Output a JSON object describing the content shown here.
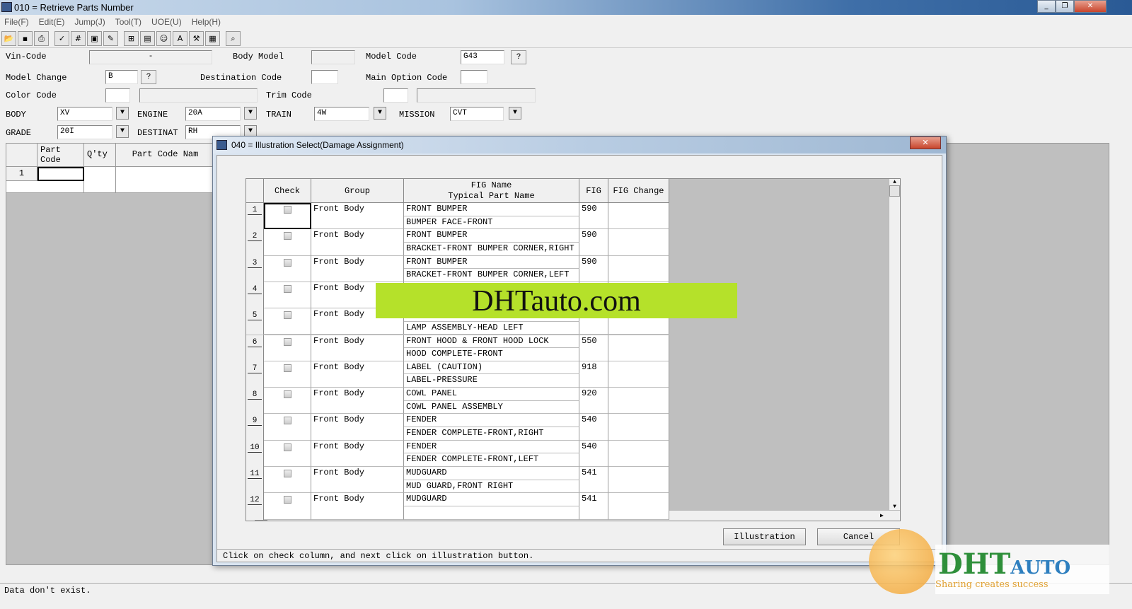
{
  "window": {
    "title": "010 = Retrieve Parts Number",
    "controls": [
      "_",
      "❐",
      "✕"
    ]
  },
  "menu": [
    "File(F)",
    "Edit(E)",
    "Jump(J)",
    "Tool(T)",
    "UOE(U)",
    "Help(H)"
  ],
  "toolbar": [
    "open-icon",
    "save-icon",
    "print-icon",
    "check-123-icon",
    "number-icon",
    "save-green-icon",
    "edit-red-icon",
    "grid-icon",
    "form-icon",
    "search-user-icon",
    "font-icon",
    "tool-icon",
    "calculator-icon",
    "find-icon"
  ],
  "form": {
    "vin_label": "Vin-Code",
    "vin_value": "-",
    "body_model_label": "Body Model",
    "body_model_value": "",
    "model_code_label": "Model Code",
    "model_code_value": "G43",
    "help": "?",
    "model_change_label": "Model Change",
    "model_change_value": "B",
    "destination_code_label": "Destination Code",
    "destination_code_value": "",
    "main_option_label": "Main Option Code",
    "main_option_value": "",
    "color_code_label": "Color Code",
    "trim_code_label": "Trim Code",
    "body_label": "BODY",
    "body_value": "XV",
    "engine_label": "ENGINE",
    "engine_value": "20A",
    "train_label": "TRAIN",
    "train_value": "4W",
    "mission_label": "MISSION",
    "mission_value": "CVT",
    "grade_label": "GRADE",
    "grade_value": "20I",
    "destinat_label": "DESTINAT",
    "destinat_value": "RH"
  },
  "parts_grid": {
    "headers": [
      "Part Code",
      "Q'ty",
      "Part Code Nam"
    ],
    "row_number": "1"
  },
  "status": "Data don't exist.",
  "dialog": {
    "title": "040 = Illustration Select(Damage Assignment)",
    "headers": {
      "check": "Check",
      "group": "Group",
      "fig_name": "FIG Name",
      "typical": "Typical Part Name",
      "fig": "FIG",
      "fig_change": "FIG Change"
    },
    "rows": [
      {
        "n": "1",
        "group": "Front Body",
        "name": "FRONT BUMPER",
        "part": "BUMPER FACE-FRONT",
        "fig": "590"
      },
      {
        "n": "2",
        "group": "Front Body",
        "name": "FRONT BUMPER",
        "part": "BRACKET-FRONT BUMPER CORNER,RIGHT",
        "fig": "590"
      },
      {
        "n": "3",
        "group": "Front Body",
        "name": "FRONT BUMPER",
        "part": "BRACKET-FRONT BUMPER CORNER,LEFT",
        "fig": "590"
      },
      {
        "n": "4",
        "group": "Front Body",
        "name": "",
        "part": "",
        "fig": ""
      },
      {
        "n": "5",
        "group": "Front Body",
        "name": "",
        "part": "LAMP ASSEMBLY-HEAD LEFT",
        "fig": ""
      },
      {
        "n": "6",
        "group": "Front Body",
        "name": "FRONT HOOD & FRONT HOOD LOCK",
        "part": "HOOD COMPLETE-FRONT",
        "fig": "550"
      },
      {
        "n": "7",
        "group": "Front Body",
        "name": "LABEL (CAUTION)",
        "part": "LABEL-PRESSURE",
        "fig": "918"
      },
      {
        "n": "8",
        "group": "Front Body",
        "name": "COWL PANEL",
        "part": "COWL PANEL ASSEMBLY",
        "fig": "920"
      },
      {
        "n": "9",
        "group": "Front Body",
        "name": "FENDER",
        "part": "FENDER COMPLETE-FRONT,RIGHT",
        "fig": "540"
      },
      {
        "n": "10",
        "group": "Front Body",
        "name": "FENDER",
        "part": "FENDER COMPLETE-FRONT,LEFT",
        "fig": "540"
      },
      {
        "n": "11",
        "group": "Front Body",
        "name": "MUDGUARD",
        "part": "MUD GUARD,FRONT RIGHT",
        "fig": "541"
      },
      {
        "n": "12",
        "group": "Front Body",
        "name": "MUDGUARD",
        "part": "",
        "fig": "541"
      }
    ],
    "illustration_button": "Illustration",
    "cancel_button": "Cancel",
    "hint": "Click on check column, and next click on illustration button."
  },
  "watermark": "DHTauto.com",
  "logo": {
    "text": "DHT AUTO",
    "tagline": "Sharing creates success"
  }
}
